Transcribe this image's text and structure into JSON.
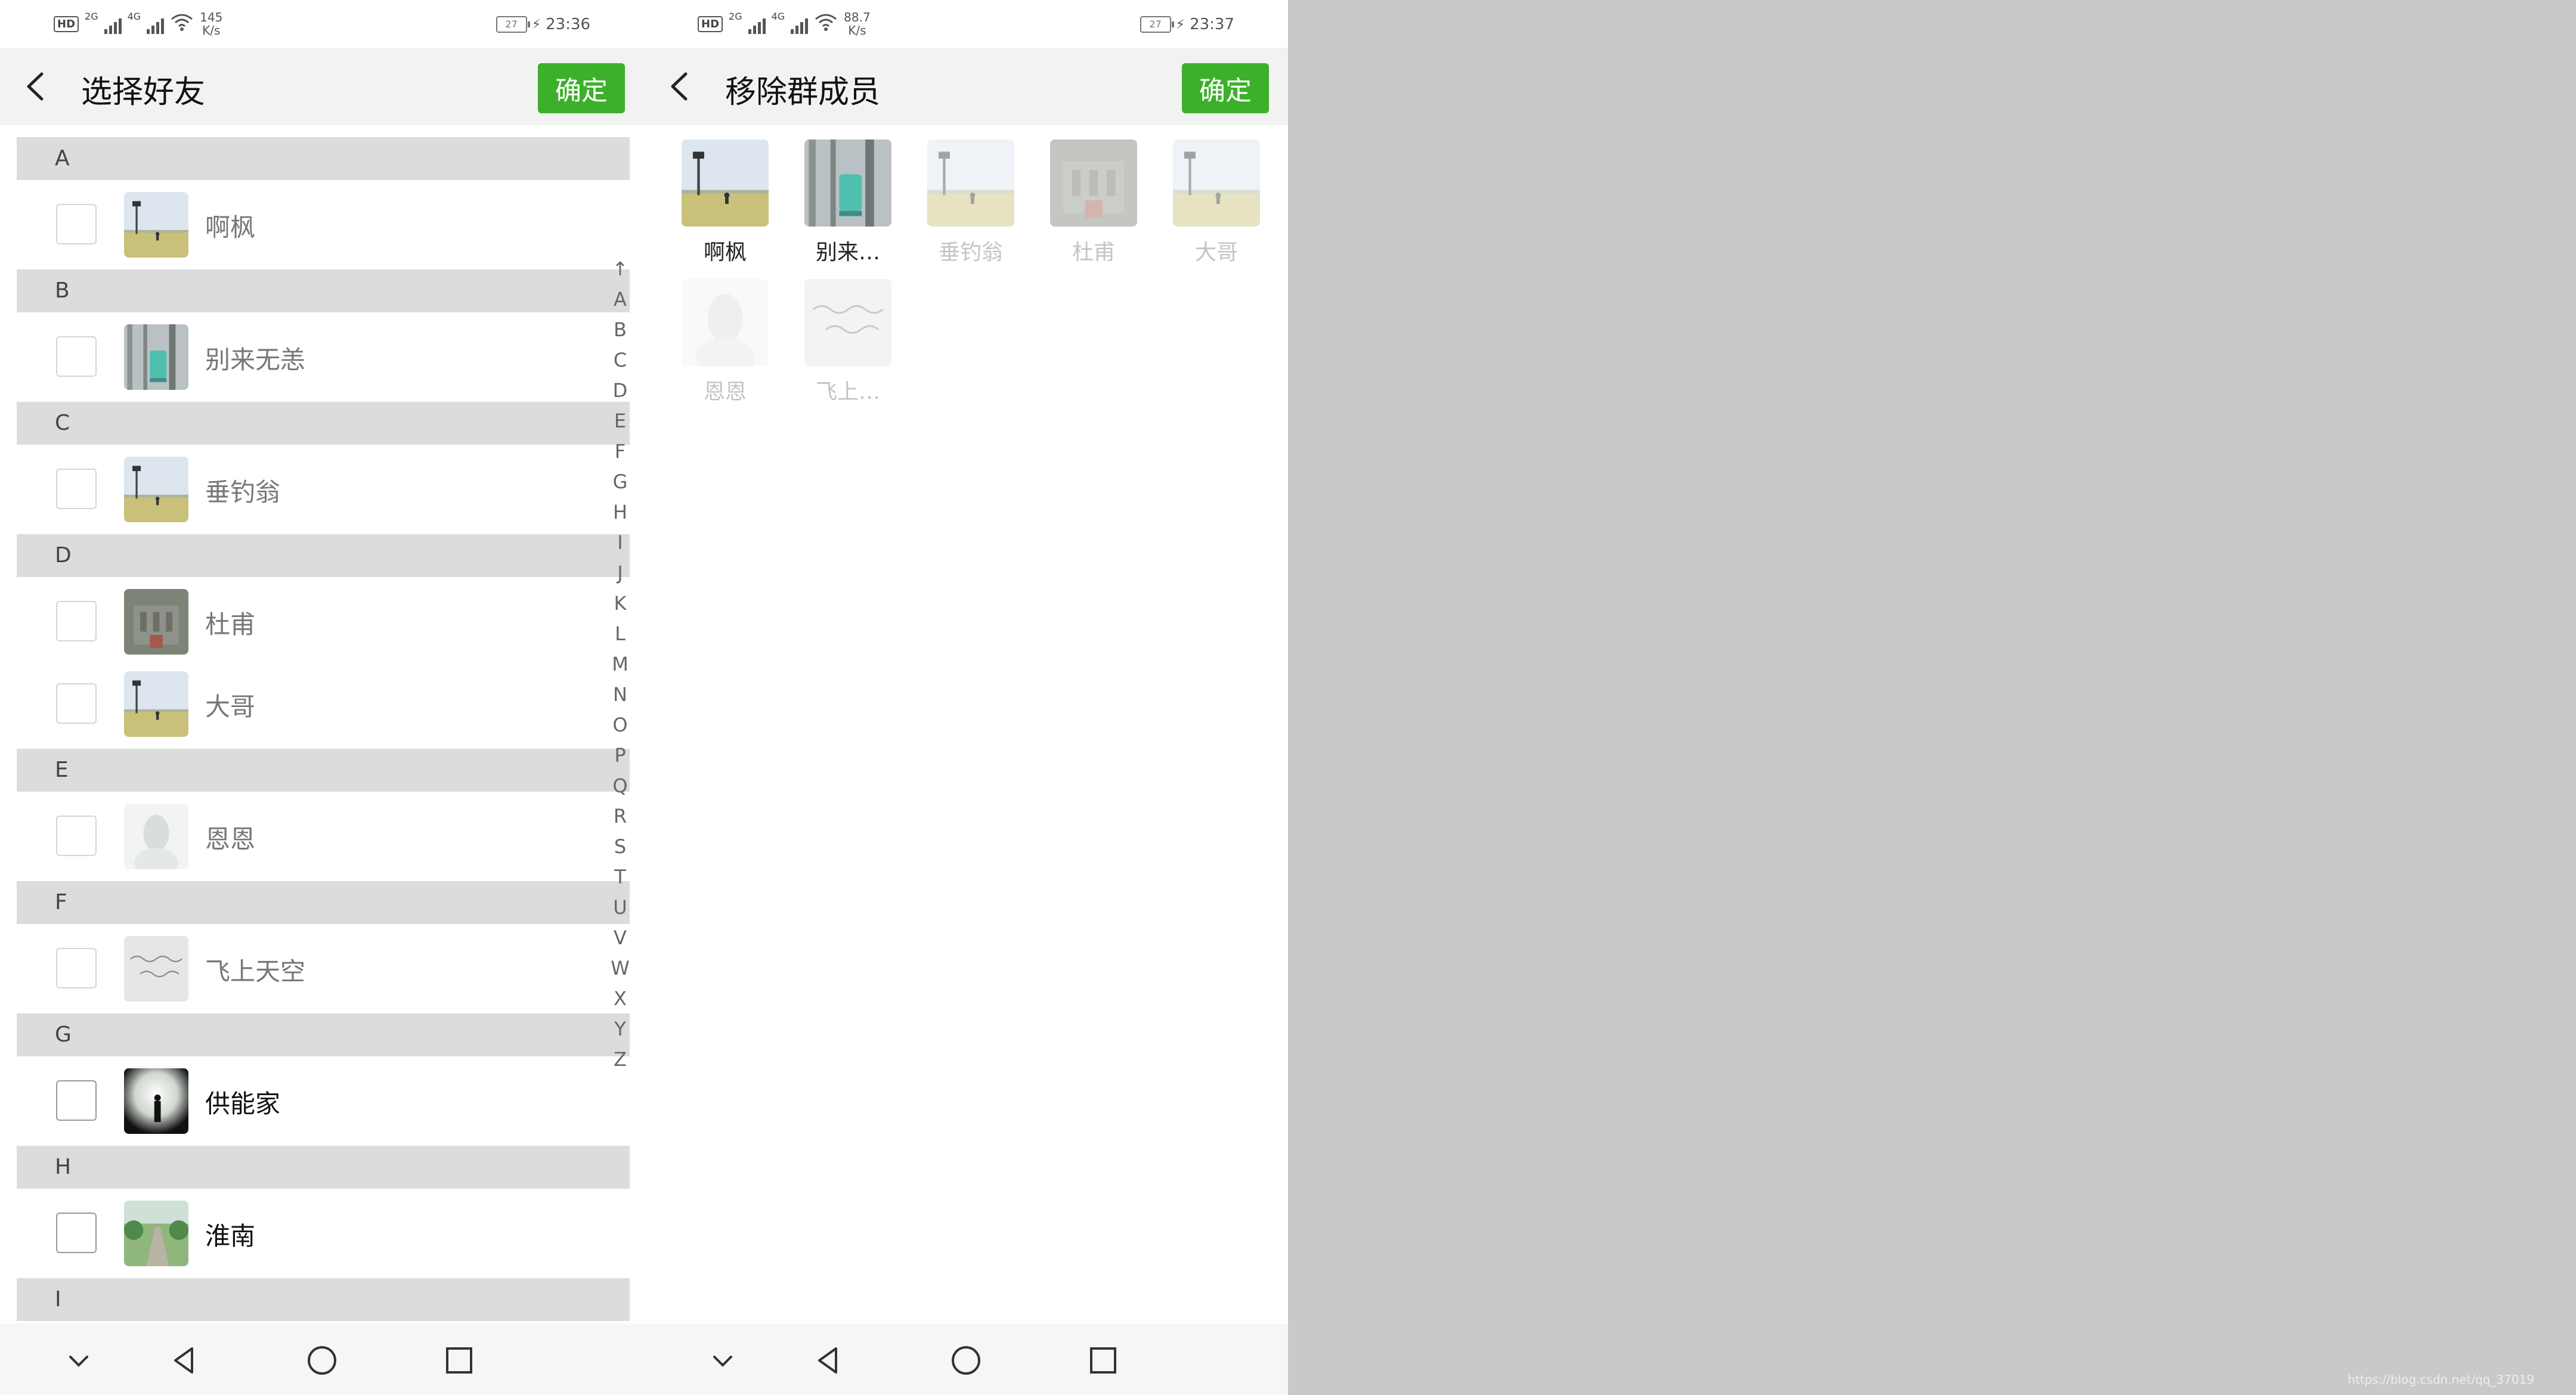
{
  "colors": {
    "accent": "#3cb02a",
    "section_bg": "#dcdcdc",
    "page_bg": "#c9c9c9"
  },
  "left": {
    "status": {
      "hd": "HD",
      "gen1": "2G",
      "gen2": "4G",
      "speed_value": "145",
      "speed_unit": "K/s",
      "battery": "27",
      "time": "23:36"
    },
    "title": "选择好友",
    "confirm_label": "确定",
    "sections": [
      {
        "letter": "A",
        "friends": [
          {
            "name": "啊枫",
            "avatar": "field-tower",
            "active": false
          }
        ]
      },
      {
        "letter": "B",
        "friends": [
          {
            "name": "别来无恙",
            "avatar": "teal-tree",
            "active": false
          }
        ]
      },
      {
        "letter": "C",
        "friends": [
          {
            "name": "垂钓翁",
            "avatar": "field-tower",
            "active": false
          }
        ]
      },
      {
        "letter": "D",
        "friends": [
          {
            "name": "杜甫",
            "avatar": "grey-building",
            "active": false
          },
          {
            "name": "大哥",
            "avatar": "field-tower",
            "active": false
          }
        ]
      },
      {
        "letter": "E",
        "friends": [
          {
            "name": "恩恩",
            "avatar": "white-figure",
            "active": false
          }
        ]
      },
      {
        "letter": "F",
        "friends": [
          {
            "name": "飞上天空",
            "avatar": "handwriting",
            "active": false
          }
        ]
      },
      {
        "letter": "G",
        "friends": [
          {
            "name": "供能家",
            "avatar": "silhouette",
            "active": true
          }
        ]
      },
      {
        "letter": "H",
        "friends": [
          {
            "name": "淮南",
            "avatar": "park-path",
            "active": true
          }
        ]
      },
      {
        "letter": "I",
        "friends": []
      }
    ],
    "index_letters": [
      "↑",
      "A",
      "B",
      "C",
      "D",
      "E",
      "F",
      "G",
      "H",
      "I",
      "J",
      "K",
      "L",
      "M",
      "N",
      "O",
      "P",
      "Q",
      "R",
      "S",
      "T",
      "U",
      "V",
      "W",
      "X",
      "Y",
      "Z"
    ]
  },
  "right": {
    "status": {
      "hd": "HD",
      "gen1": "2G",
      "gen2": "4G",
      "speed_value": "88.7",
      "speed_unit": "K/s",
      "battery": "27",
      "time": "23:37"
    },
    "title": "移除群成员",
    "confirm_label": "确定",
    "members": [
      {
        "name": "啊枫",
        "avatar": "field-tower",
        "faded": false
      },
      {
        "name": "别来…",
        "avatar": "teal-tree",
        "faded": false
      },
      {
        "name": "垂钓翁",
        "avatar": "field-tower",
        "faded": true
      },
      {
        "name": "杜甫",
        "avatar": "grey-building",
        "faded": true
      },
      {
        "name": "大哥",
        "avatar": "field-tower",
        "faded": true
      },
      {
        "name": "恩恩",
        "avatar": "white-figure",
        "faded": true
      },
      {
        "name": "飞上…",
        "avatar": "handwriting",
        "faded": true
      }
    ]
  },
  "watermark": "https://blog.csdn.net/qq_37019"
}
